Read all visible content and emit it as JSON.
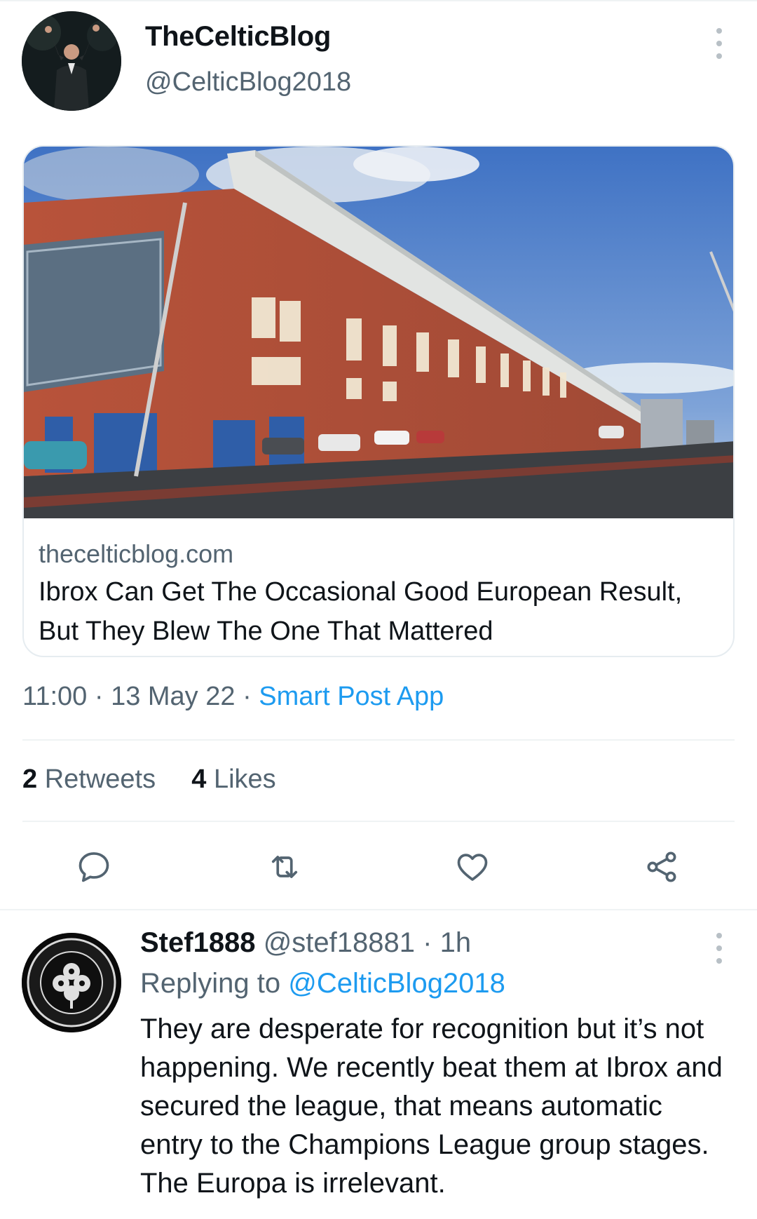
{
  "tweet": {
    "display_name": "TheCelticBlog",
    "handle": "@CelticBlog2018",
    "card": {
      "domain": "thecelticblog.com",
      "title": "Ibrox Can Get The Occasional Good European Result, But They Blew The One That Mattered"
    },
    "time": "11:00",
    "date": "13 May 22",
    "separator": "·",
    "source_app": "Smart Post App",
    "retweets_count": "2",
    "retweets_label": "Retweets",
    "likes_count": "4",
    "likes_label": "Likes"
  },
  "actions": [
    {
      "name": "reply",
      "icon": "reply-icon"
    },
    {
      "name": "retweet",
      "icon": "retweet-icon"
    },
    {
      "name": "like",
      "icon": "heart-icon"
    },
    {
      "name": "share",
      "icon": "share-icon"
    }
  ],
  "reply": {
    "display_name": "Stef1888",
    "handle": "@stef18881",
    "separator": "·",
    "age": "1h",
    "replying_prefix": "Replying to",
    "replying_to": "@CelticBlog2018",
    "text": "They are desperate for recognition but it’s not happening. We recently beat them at Ibrox and secured the league, that means automatic entry to the Champions League group stages. The Europa is irrelevant."
  },
  "colors": {
    "accent": "#1d9bf0",
    "secondary_text": "#536471",
    "primary_text": "#0f1419",
    "divider": "#eff3f4"
  }
}
